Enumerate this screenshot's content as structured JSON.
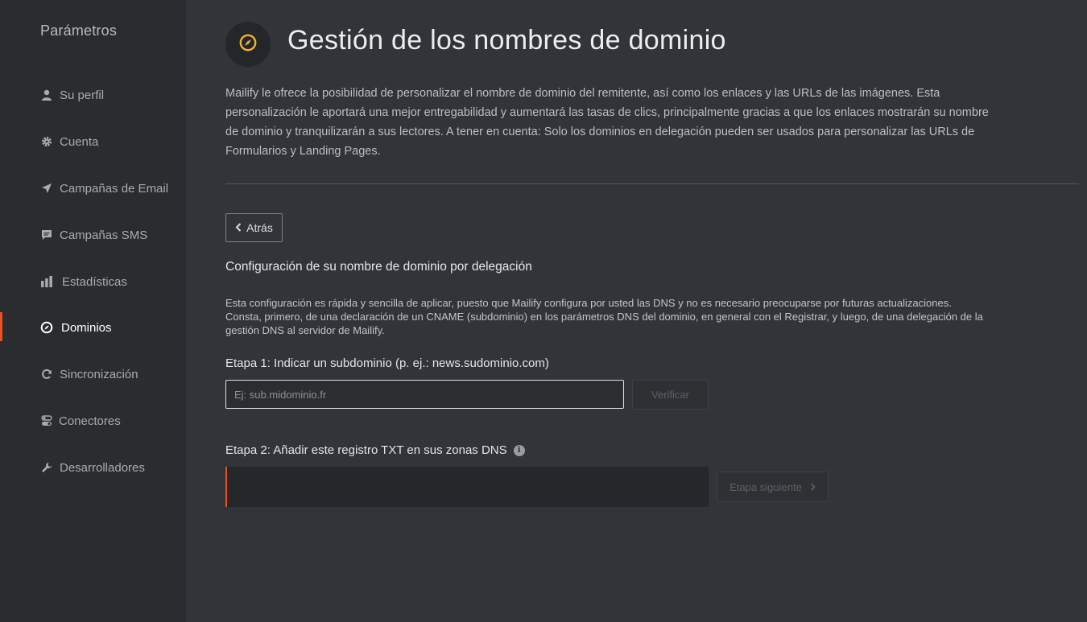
{
  "sidebar": {
    "title": "Parámetros",
    "items": [
      {
        "label": "Su perfil",
        "icon": "user-icon"
      },
      {
        "label": "Cuenta",
        "icon": "gear-icon"
      },
      {
        "label": "Campañas de Email",
        "icon": "paper-plane-icon"
      },
      {
        "label": "Campañas SMS",
        "icon": "chat-bubble-icon"
      },
      {
        "label": "Estadísticas",
        "icon": "bar-chart-icon"
      },
      {
        "label": "Dominios",
        "icon": "compass-icon",
        "active": true
      },
      {
        "label": "Sincronización",
        "icon": "refresh-icon"
      },
      {
        "label": "Conectores",
        "icon": "toggle-icon"
      },
      {
        "label": "Desarrolladores",
        "icon": "wrench-icon"
      }
    ]
  },
  "header": {
    "icon": "compass-icon",
    "title": "Gestión de los nombres de dominio"
  },
  "intro": "Mailify le ofrece la posibilidad de personalizar el nombre de dominio del remitente, así como los enlaces y las URLs de las imágenes. Esta personalización le aportará una mejor entregabilidad y aumentará las tasas de clics, principalmente gracias a que los enlaces mostrarán su nombre de dominio y tranquilizarán a sus lectores. A tener en cuenta: Solo los dominios en delegación pueden ser usados para personalizar las URLs de Formularios y Landing Pages.",
  "back_label": "Atrás",
  "section": {
    "title": "Configuración de su nombre de dominio por delegación",
    "description": "Esta configuración es rápida y sencilla de aplicar, puesto que Mailify configura por usted las DNS y no es necesario preocuparse por futuras actualizaciones. Consta, primero, de una declaración de un CNAME (subdominio) en los parámetros DNS del dominio, en general con el Registrar, y luego, de una delegación de la gestión DNS al servidor de Mailify."
  },
  "step1": {
    "label": "Etapa 1: Indicar un subdominio (p. ej.: news.sudominio.com)",
    "placeholder": "Ej: sub.midominio.fr",
    "value": "",
    "verify_label": "Verificar"
  },
  "step2": {
    "label": "Etapa 2: Añadir este registro TXT en sus zonas DNS",
    "record": "",
    "next_label": "Etapa siguiente"
  },
  "colors": {
    "accent": "#e8531e",
    "badge_icon": "#f0b429"
  }
}
